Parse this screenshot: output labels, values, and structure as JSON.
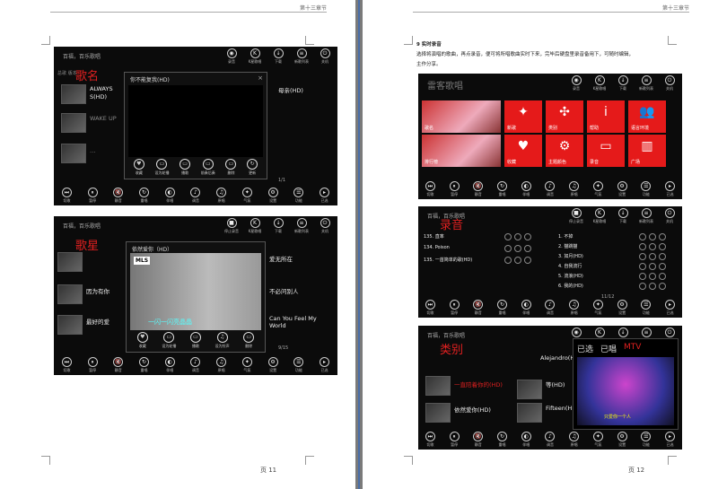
{
  "pages": [
    {
      "header": "第十三章节",
      "page_label": "页 11"
    },
    {
      "header": "第十三章节",
      "page_label": "页 12"
    }
  ],
  "page12_text": {
    "heading": "9 实时录音",
    "body": "选择将演唱的歌曲，再点录音，便可将所唱歌曲实时下来，完毕后硬盘里录音备用下，可随时编辑，",
    "body2": "主作分享。"
  },
  "app_titles": {
    "small": "百福，百乐歌唱",
    "big": "雷客歌唱"
  },
  "top_icons": [
    {
      "glyph": "◉",
      "label": "录音"
    },
    {
      "glyph": "K",
      "label": "K星歌唱"
    },
    {
      "glyph": "↓",
      "label": "下载"
    },
    {
      "glyph": "≡",
      "label": "新歌列表"
    },
    {
      "glyph": "⏻",
      "label": "关机"
    }
  ],
  "top_icons_s2": [
    {
      "glyph": "■",
      "label": "停止录音"
    },
    {
      "glyph": "K",
      "label": "K星歌唱"
    },
    {
      "glyph": "↓",
      "label": "下载"
    },
    {
      "glyph": "≡",
      "label": "新歌列表"
    },
    {
      "glyph": "⏻",
      "label": "关机"
    }
  ],
  "bottom_icons": [
    {
      "glyph": "⏭",
      "label": "切歌"
    },
    {
      "glyph": "⏸",
      "label": "暂停"
    },
    {
      "glyph": "🔇",
      "label": "静音"
    },
    {
      "glyph": "↻",
      "label": "重唱"
    },
    {
      "glyph": "◐",
      "label": "伴唱"
    },
    {
      "glyph": "♪",
      "label": "调音"
    },
    {
      "glyph": "♫",
      "label": "原唱"
    },
    {
      "glyph": "✦",
      "label": "气氛"
    },
    {
      "glyph": "⚙",
      "label": "设置"
    },
    {
      "glyph": "☰",
      "label": "功能"
    },
    {
      "glyph": "▸",
      "label": "已选"
    }
  ],
  "shot1": {
    "category": "歌名",
    "subtitle": "总歌 版本",
    "rows": [
      {
        "title": "ALWAYS",
        "sub": "S(HD)"
      },
      {
        "title": "WAKE UP",
        "sub": ""
      },
      {
        "title": "…",
        "sub": ""
      }
    ],
    "right_rows": [
      "母亲(HD)",
      "",
      ""
    ],
    "dialog_title": "你不能复我(HD)",
    "dialog_buttons": [
      {
        "glyph": "♥",
        "label": "收藏"
      },
      {
        "glyph": "▭",
        "label": "设为轮播"
      },
      {
        "glyph": "▭",
        "label": "播歌"
      },
      {
        "glyph": "▭",
        "label": "前奏后奏"
      },
      {
        "glyph": "▭",
        "label": "删除"
      },
      {
        "glyph": "↻",
        "label": "更新"
      }
    ],
    "pager": "1/1"
  },
  "shot2": {
    "category": "歌星",
    "rows": [
      "因为有你",
      "最好的爱"
    ],
    "right_rows": [
      "爱无所在",
      "不必问别人",
      "Can You Feel My World"
    ],
    "dialog_title": "依然爱你（HD）",
    "logo": "MLS",
    "caption": "一闪一闪亮晶晶",
    "dialog_buttons": [
      {
        "glyph": "♥",
        "label": "收藏"
      },
      {
        "glyph": "▭",
        "label": "设为轮播"
      },
      {
        "glyph": "▭",
        "label": "播歌"
      },
      {
        "glyph": "♫",
        "label": "设为铃声"
      },
      {
        "glyph": "▭",
        "label": "删除"
      }
    ],
    "pager": "9/15"
  },
  "shot3": {
    "tiles": [
      {
        "glyph": "♛",
        "label": "歌名",
        "photo": true
      },
      {
        "glyph": "✦",
        "label": "新歌"
      },
      {
        "glyph": "✣",
        "label": "类别"
      },
      {
        "glyph": "i",
        "label": "帮助"
      },
      {
        "glyph": "👥",
        "label": "语言环境"
      },
      {
        "glyph": "▦",
        "label": "排行榜",
        "photo": true
      },
      {
        "glyph": "♥",
        "label": "收藏"
      },
      {
        "glyph": "⚙",
        "label": "主题颜色"
      },
      {
        "glyph": "▭",
        "label": "录音"
      },
      {
        "glyph": "▥",
        "label": "广场"
      }
    ]
  },
  "shot4": {
    "category": "录音",
    "left_rows": [
      "135. 直率",
      "134. Poison",
      "135. 一首简单的歌(HD)"
    ],
    "right_rows": [
      "1. 不掉",
      "2. 猫跳猫",
      "3. 如月(HD)",
      "4. 自我流行",
      "5. 流浪(HD)",
      "6. 我的(HD)"
    ],
    "pager": "11/12"
  },
  "shot5": {
    "category": "类别",
    "rows": [
      "Alejandro(HD)",
      "一直陪着你的(HD)",
      "依然爱你(HD)"
    ],
    "right_rows": [
      "等(HD)",
      "Fifteen(HD)"
    ],
    "tabs": [
      "已选",
      "已唱",
      "MTV"
    ],
    "caption": "只爱你一个人"
  }
}
